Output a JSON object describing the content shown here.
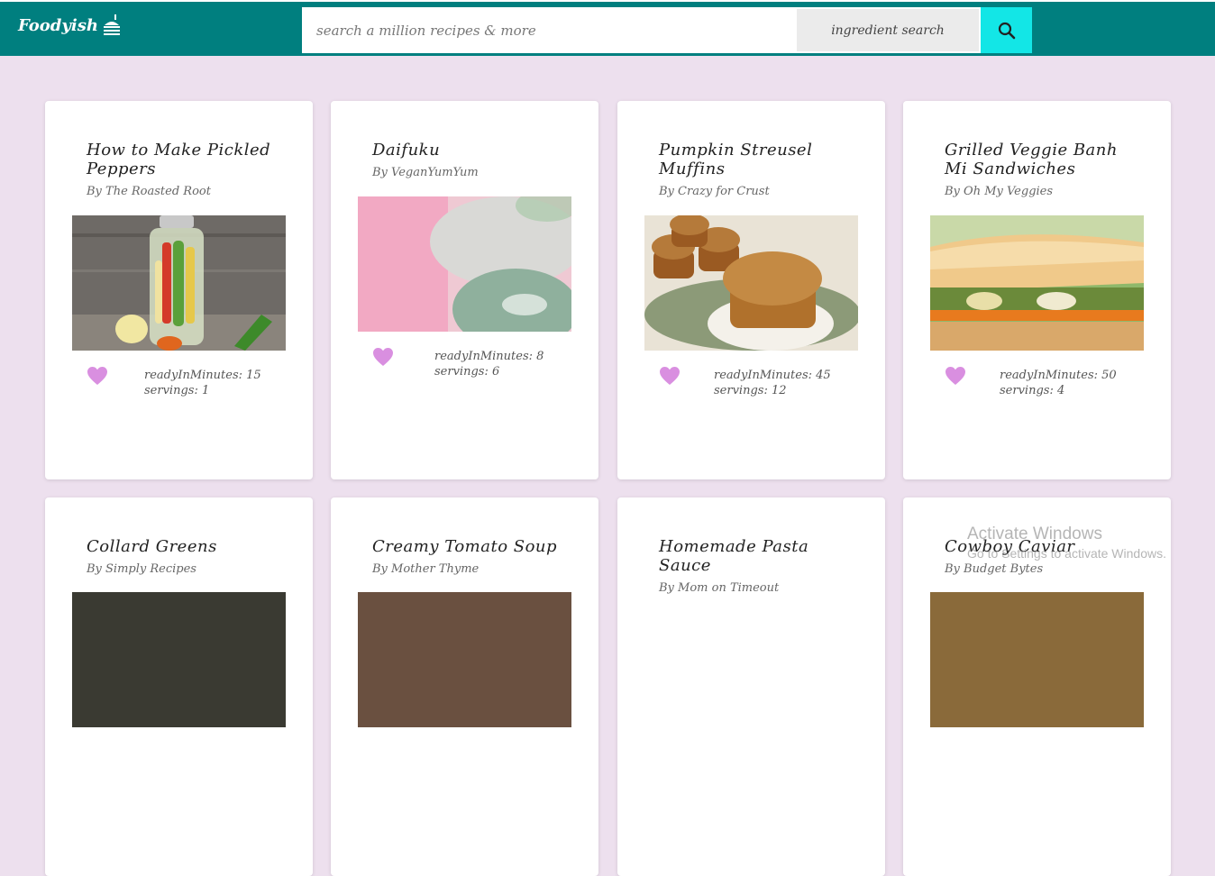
{
  "header": {
    "logo_text": "Foodyish",
    "search_placeholder": "search a million recipes & more",
    "ingredient_label": "ingredient search",
    "search_icon": "search-icon",
    "color_bar": "#007f7f",
    "color_search_btn": "#13e6e6"
  },
  "recipes": [
    {
      "title": "How to Make Pickled Peppers",
      "author": "By The Roasted Root",
      "ready": "readyInMinutes: 15",
      "servings": "servings: 1"
    },
    {
      "title": "Daifuku",
      "author": "By VeganYumYum",
      "ready": "readyInMinutes: 8",
      "servings": "servings: 6"
    },
    {
      "title": "Pumpkin Streusel Muffins",
      "author": "By Crazy for Crust",
      "ready": "readyInMinutes: 45",
      "servings": "servings: 12"
    },
    {
      "title": "Grilled Veggie Banh Mi Sandwiches",
      "author": "By Oh My Veggies",
      "ready": "readyInMinutes: 50",
      "servings": "servings: 4"
    },
    {
      "title": "Collard Greens",
      "author": "By Simply Recipes"
    },
    {
      "title": "Creamy Tomato Soup",
      "author": "By Mother Thyme"
    },
    {
      "title": "Homemade Pasta Sauce",
      "author": "By Mom on Timeout"
    },
    {
      "title": "Cowboy Caviar",
      "author": "By Budget Bytes"
    }
  ],
  "watermark": {
    "title": "Activate Windows",
    "subtitle": "Go to Settings to activate Windows."
  },
  "colors": {
    "page_bg": "#ede0ee",
    "heart": "#d98fe0"
  }
}
